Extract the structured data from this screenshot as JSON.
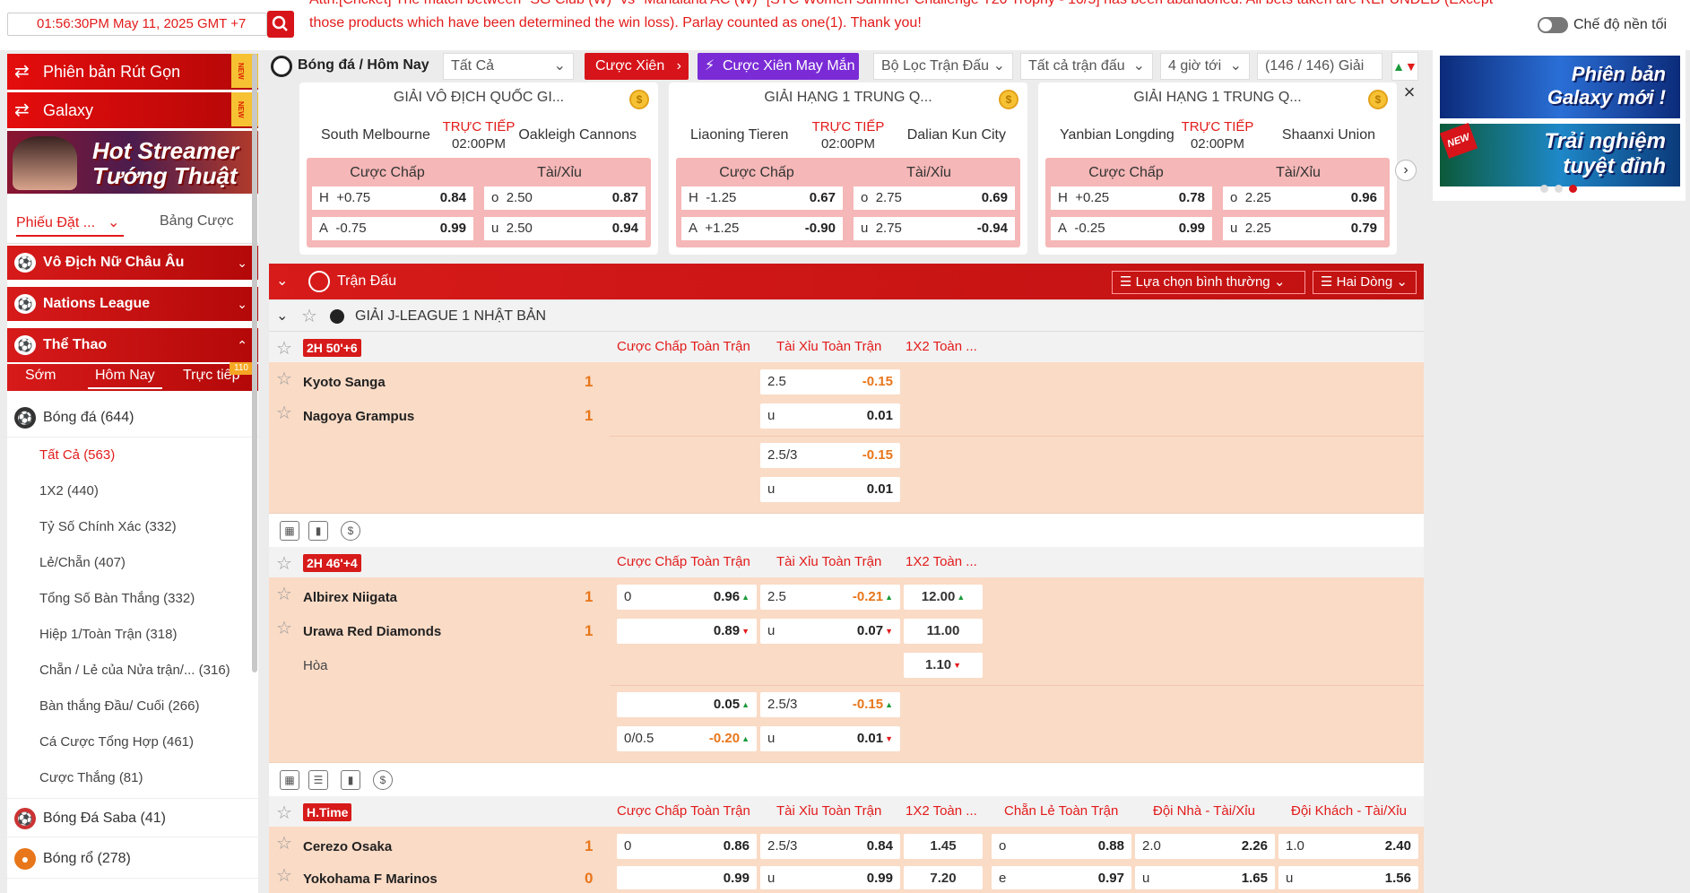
{
  "topbar": {
    "clock": "01:56:30PM May 11, 2025 GMT +7",
    "ticker_line1": "Attn:[Cricket] The match between \"SG Club (W)\" vs \"Mahalaha AC (W)\" [STC Women Summer Challenge T20 Trophy - 10/5] has been abandoned. All bets taken are REFUNDED (Except",
    "ticker_line2": "those products which have been determined the win loss). Parlay counted as one(1). Thank you!",
    "night_mode_label": "Chế độ nền tối"
  },
  "sidebar": {
    "promo1": "Phiên bản Rút Gọn",
    "promo2": "Galaxy",
    "new_tag": "NEW",
    "streamer_line1": "Hot Streamer",
    "streamer_line2": "Tướng Thuật",
    "tab_slip": "Phiếu Đặt ...",
    "tab_board": "Bảng Cược",
    "sections": [
      {
        "label": "Vô Địch Nữ Châu Âu",
        "chevron": "⌄"
      },
      {
        "label": "Nations League",
        "chevron": "⌄"
      },
      {
        "label": "Thể Thao",
        "chevron": "⌃"
      }
    ],
    "subtabs": [
      "Sớm",
      "Hôm Nay",
      "Trực tiếp"
    ],
    "live_count": "110",
    "sport_main": {
      "label": "Bóng đá",
      "count": "(644)"
    },
    "sub_items": [
      {
        "label": "Tất Cả",
        "count": "(563)"
      },
      {
        "label": "1X2",
        "count": "(440)"
      },
      {
        "label": "Tỷ Số Chính Xác",
        "count": "(332)"
      },
      {
        "label": "Lẻ/Chẵn",
        "count": "(407)"
      },
      {
        "label": "Tổng Số Bàn Thắng",
        "count": "(332)"
      },
      {
        "label": "Hiệp 1/Toàn Trận",
        "count": "(318)"
      },
      {
        "label": "Chẵn / Lẻ của Nửa trận/...",
        "count": "(316)"
      },
      {
        "label": "Bàn thắng Đầu/ Cuối",
        "count": "(266)"
      },
      {
        "label": "Cá Cược Tổng Hợp",
        "count": "(461)"
      },
      {
        "label": "Cược Thắng",
        "count": "(81)"
      }
    ],
    "sport_saba": {
      "label": "Bóng Đá Saba",
      "count": "(41)"
    },
    "sport_basket": {
      "label": "Bóng rổ",
      "count": "(278)"
    }
  },
  "toolbar": {
    "breadcrumb": "Bóng đá / Hôm Nay",
    "filter_all": "Tất Cả",
    "parlay": "Cược Xiên",
    "lucky_parlay": "Cược Xiên May Mắn",
    "match_filter": "Bộ Lọc Trận Đấu",
    "all_matches": "Tất cả trận đấu",
    "time_window": "4 giờ tới",
    "league_count": "(146 / 146) Giải"
  },
  "featured": [
    {
      "league": "GIẢI VÔ ĐỊCH QUỐC GI...",
      "home": "South Melbourne",
      "away": "Oakleigh Cannons",
      "live": "TRỰC TIẾP",
      "time": "02:00PM",
      "hdp_label": "Cược Chấp",
      "ou_label": "Tài/Xỉu",
      "h": "H",
      "h_line": "+0.75",
      "h_odds": "0.84",
      "a": "A",
      "a_line": "-0.75",
      "a_odds": "0.99",
      "o": "o",
      "o_line": "2.50",
      "o_odds": "0.87",
      "u": "u",
      "u_line": "2.50",
      "u_odds": "0.94"
    },
    {
      "league": "GIẢI HẠNG 1 TRUNG Q...",
      "home": "Liaoning Tieren",
      "away": "Dalian Kun City",
      "live": "TRỰC TIẾP",
      "time": "02:00PM",
      "hdp_label": "Cược Chấp",
      "ou_label": "Tài/Xỉu",
      "h": "H",
      "h_line": "-1.25",
      "h_odds": "0.67",
      "a": "A",
      "a_line": "+1.25",
      "a_odds": "-0.90",
      "o": "o",
      "o_line": "2.75",
      "o_odds": "0.69",
      "u": "u",
      "u_line": "2.75",
      "u_odds": "-0.94"
    },
    {
      "league": "GIẢI HẠNG 1 TRUNG Q...",
      "home": "Yanbian Longding",
      "away": "Shaanxi Union",
      "live": "TRỰC TIẾP",
      "time": "02:00PM",
      "hdp_label": "Cược Chấp",
      "ou_label": "Tài/Xỉu",
      "h": "H",
      "h_line": "+0.25",
      "h_odds": "0.78",
      "a": "A",
      "a_line": "-0.25",
      "a_odds": "0.99",
      "o": "o",
      "o_line": "2.25",
      "o_odds": "0.96",
      "u": "u",
      "u_line": "2.25",
      "u_odds": "0.79"
    }
  ],
  "match_header": {
    "title": "Trận Đấu",
    "select_mode": "Lựa chọn bình thường",
    "select_rows": "Hai Dòng"
  },
  "league": {
    "name": "GIẢI J-LEAGUE 1 NHẬT BẢN"
  },
  "columns": {
    "hdp": "Cược Chấp Toàn Trận",
    "ou": "Tài Xỉu Toàn Trận",
    "x12": "1X2 Toàn ...",
    "oe": "Chẵn Lẻ Toàn Trận",
    "home_ou": "Đội Nhà - Tài/Xỉu",
    "away_ou": "Đội Khách - Tài/Xỉu"
  },
  "matches": [
    {
      "status": "2H  50'+6",
      "home": "Kyoto Sanga",
      "away": "Nagoya Grampus",
      "home_score": "1",
      "away_score": "1",
      "ou1_line": "2.5",
      "ou1_odds": "-0.15",
      "ou1_u": "u",
      "ou1_u_odds": "0.01",
      "ou2_line": "2.5/3",
      "ou2_odds": "-0.15",
      "ou2_u": "u",
      "ou2_u_odds": "0.01"
    },
    {
      "status": "2H  46'+4",
      "home": "Albirex Niigata",
      "away": "Urawa Red Diamonds",
      "draw": "Hòa",
      "home_score": "1",
      "away_score": "1",
      "hdp1_line": "0",
      "hdp1_h": "0.96",
      "hdp1_a": "0.89",
      "ou1_line": "2.5",
      "ou1_odds": "-0.21",
      "ou1_u": "u",
      "ou1_u_odds": "0.07",
      "x1": "12.00",
      "x2": "11.00",
      "xd": "1.10",
      "hdp2_h": "0.05",
      "hdp2_line": "0/0.5",
      "hdp2_a": "-0.20",
      "ou2_line": "2.5/3",
      "ou2_odds": "-0.15",
      "ou2_u": "u",
      "ou2_u_odds": "0.01"
    },
    {
      "status": "H.Time",
      "home": "Cerezo Osaka",
      "away": "Yokohama F Marinos",
      "home_score": "1",
      "away_score": "0",
      "hdp_line": "0",
      "hdp_h": "0.86",
      "hdp_a": "0.99",
      "ou_line": "2.5/3",
      "ou_o": "0.84",
      "ou_u": "u",
      "ou_u_odds": "0.99",
      "x1": "1.45",
      "x2": "7.20",
      "oe_o": "o",
      "oe_o_odds": "0.88",
      "oe_e": "e",
      "oe_e_odds": "0.97",
      "hou_line": "2.0",
      "hou_o": "2.26",
      "hou_u": "u",
      "hou_u_odds": "1.65",
      "aou_line": "1.0",
      "aou_o": "2.40",
      "aou_u": "u",
      "aou_u_odds": "1.56"
    }
  ],
  "right_banners": {
    "b1_line1": "Phiên bản",
    "b1_line2": "Galaxy mới !",
    "b2_line1": "Trải nghiệm",
    "b2_line2": "tuyệt đỉnh",
    "b2_tag": "NEW"
  }
}
